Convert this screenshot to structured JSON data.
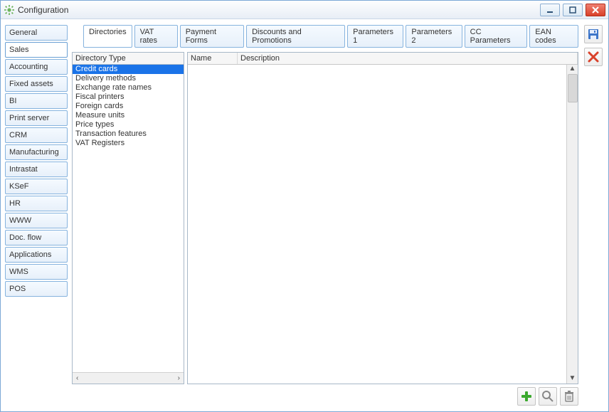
{
  "window": {
    "title": "Configuration"
  },
  "sidebar": {
    "items": [
      "General",
      "Sales",
      "Accounting",
      "Fixed assets",
      "BI",
      "Print server",
      "CRM",
      "Manufacturing",
      "Intrastat",
      "KSeF",
      "HR",
      "WWW",
      "Doc. flow",
      "Applications",
      "WMS",
      "POS"
    ],
    "active_index": 1
  },
  "tabs": {
    "items": [
      "Directories",
      "VAT rates",
      "Payment Forms",
      "Discounts and Promotions",
      "Parameters 1",
      "Parameters 2",
      "CC Parameters",
      "EAN codes"
    ],
    "active_index": 0
  },
  "directory_panel": {
    "header": "Directory Type",
    "items": [
      "Credit cards",
      "Delivery methods",
      "Exchange rate names",
      "Fiscal printers",
      "Foreign cards",
      "Measure units",
      "Price types",
      "Transaction features",
      "VAT Registers"
    ],
    "selected_index": 0
  },
  "grid": {
    "columns": {
      "name": "Name",
      "description": "Description"
    },
    "rows": []
  },
  "icons": {
    "app": "gear",
    "minimize": "minimize",
    "maximize": "maximize",
    "close": "close",
    "save": "floppy",
    "cancel": "red-x",
    "add": "plus-green",
    "search": "magnifier",
    "delete": "trash"
  }
}
